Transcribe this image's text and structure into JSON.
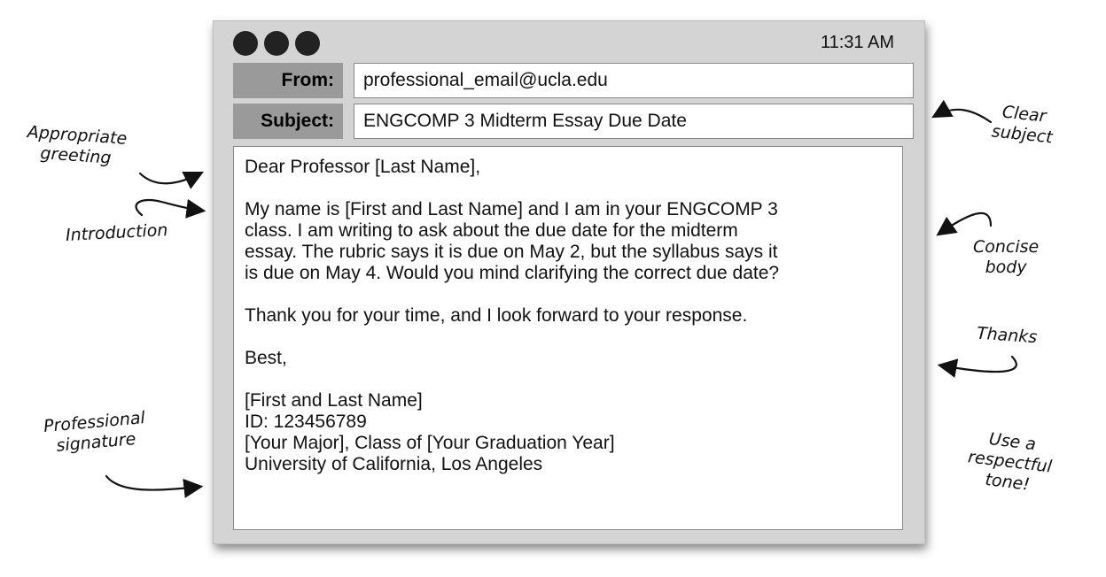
{
  "window": {
    "time": "11:31 AM",
    "from_label": "From:",
    "from_value": "professional_email@ucla.edu",
    "subject_label": "Subject:",
    "subject_value": "ENGCOMP 3 Midterm Essay Due Date"
  },
  "body": {
    "greeting": "Dear Professor [Last Name],",
    "intro_lines": [
      "My name is [First and Last Name] and I am in your ENGCOMP 3",
      "class. I am writing to ask about the due date for the midterm",
      "essay. The rubric says it is due on May 2, but the syllabus says it",
      "is due on May 4. Would you mind clarifying the correct due date?"
    ],
    "thanks": "Thank you for your time, and I look forward to your response.",
    "closing": "Best,",
    "signature": [
      "[First and Last Name]",
      "ID: 123456789",
      "[Your Major], Class of [Your Graduation Year]",
      "University of California, Los Angeles"
    ]
  },
  "annotations": {
    "greeting": [
      "Appropriate",
      "greeting"
    ],
    "introduction": [
      "Introduction"
    ],
    "signature": [
      "Professional",
      "signature"
    ],
    "subject": [
      "Clear",
      "subject"
    ],
    "body": [
      "Concise",
      "body"
    ],
    "thanks": [
      "Thanks"
    ],
    "tone": [
      "Use a",
      "respectful",
      "tone!"
    ]
  }
}
